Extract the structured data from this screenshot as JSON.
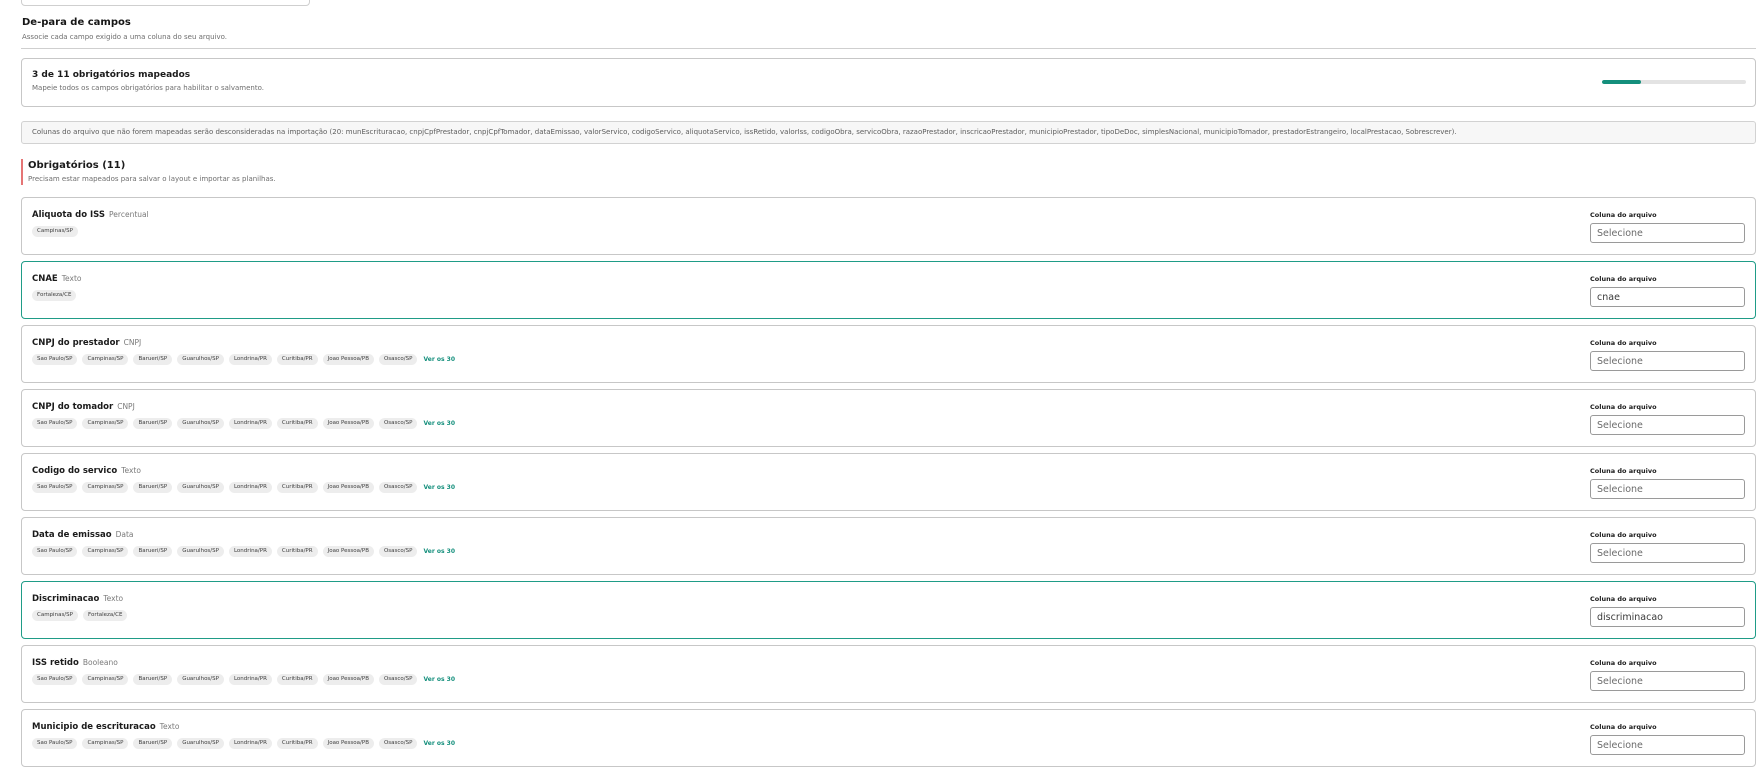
{
  "section": {
    "title": "De-para de campos",
    "subtitle": "Associe cada campo exigido a uma coluna do seu arquivo."
  },
  "progress": {
    "title": "3 de 11 obrigatórios mapeados",
    "subtitle": "Mapeie todos os campos obrigatórios para habilitar o salvamento.",
    "mapped": 3,
    "total": 11,
    "fraction": 0.27,
    "color": "#148f7c"
  },
  "notice": {
    "text": "Colunas do arquivo que não forem mapeadas serão desconsideradas na importação (20: munEscrituracao, cnpjCpfPrestador, cnpjCpfTomador, dataEmissao, valorServico, codigoServico, aliquotaServico, issRetido, valorIss, codigoObra, servicoObra, razaoPrestador, inscricaoPrestador, municipioPrestador, tipoDeDoc, simplesNacional, municipioTomador, prestadorEstrangeiro, localPrestacao, Sobrescrever)."
  },
  "required": {
    "title": "Obrigatórios (11)",
    "subtitle": "Precisam estar mapeados para salvar o layout e importar as planilhas.",
    "accent_color": "#e57575"
  },
  "column_label": "Coluna do arquivo",
  "fields": [
    {
      "name": "Aliquota do ISS",
      "type": "Percentual",
      "tags": [
        "Campinas/SP"
      ],
      "see_all": "",
      "value": "Selecione",
      "mapped": false
    },
    {
      "name": "CNAE",
      "type": "Texto",
      "tags": [
        "Fortaleza/CE"
      ],
      "see_all": "",
      "value": "cnae",
      "mapped": true
    },
    {
      "name": "CNPJ do prestador",
      "type": "CNPJ",
      "tags": [
        "Sao Paulo/SP",
        "Campinas/SP",
        "Barueri/SP",
        "Guarulhos/SP",
        "Londrina/PR",
        "Curitiba/PR",
        "Joao Pessoa/PB",
        "Osasco/SP"
      ],
      "see_all": "Ver os 30",
      "value": "Selecione",
      "mapped": false
    },
    {
      "name": "CNPJ do tomador",
      "type": "CNPJ",
      "tags": [
        "Sao Paulo/SP",
        "Campinas/SP",
        "Barueri/SP",
        "Guarulhos/SP",
        "Londrina/PR",
        "Curitiba/PR",
        "Joao Pessoa/PB",
        "Osasco/SP"
      ],
      "see_all": "Ver os 30",
      "value": "Selecione",
      "mapped": false
    },
    {
      "name": "Codigo do servico",
      "type": "Texto",
      "tags": [
        "Sao Paulo/SP",
        "Campinas/SP",
        "Barueri/SP",
        "Guarulhos/SP",
        "Londrina/PR",
        "Curitiba/PR",
        "Joao Pessoa/PB",
        "Osasco/SP"
      ],
      "see_all": "Ver os 30",
      "value": "Selecione",
      "mapped": false
    },
    {
      "name": "Data de emissao",
      "type": "Data",
      "tags": [
        "Sao Paulo/SP",
        "Campinas/SP",
        "Barueri/SP",
        "Guarulhos/SP",
        "Londrina/PR",
        "Curitiba/PR",
        "Joao Pessoa/PB",
        "Osasco/SP"
      ],
      "see_all": "Ver os 30",
      "value": "Selecione",
      "mapped": false
    },
    {
      "name": "Discriminacao",
      "type": "Texto",
      "tags": [
        "Campinas/SP",
        "Fortaleza/CE"
      ],
      "see_all": "",
      "value": "discriminacao",
      "mapped": true
    },
    {
      "name": "ISS retido",
      "type": "Booleano",
      "tags": [
        "Sao Paulo/SP",
        "Campinas/SP",
        "Barueri/SP",
        "Guarulhos/SP",
        "Londrina/PR",
        "Curitiba/PR",
        "Joao Pessoa/PB",
        "Osasco/SP"
      ],
      "see_all": "Ver os 30",
      "value": "Selecione",
      "mapped": false
    },
    {
      "name": "Municipio de escrituracao",
      "type": "Texto",
      "tags": [
        "Sao Paulo/SP",
        "Campinas/SP",
        "Barueri/SP",
        "Guarulhos/SP",
        "Londrina/PR",
        "Curitiba/PR",
        "Joao Pessoa/PB",
        "Osasco/SP"
      ],
      "see_all": "Ver os 30",
      "value": "Selecione",
      "mapped": false
    }
  ]
}
